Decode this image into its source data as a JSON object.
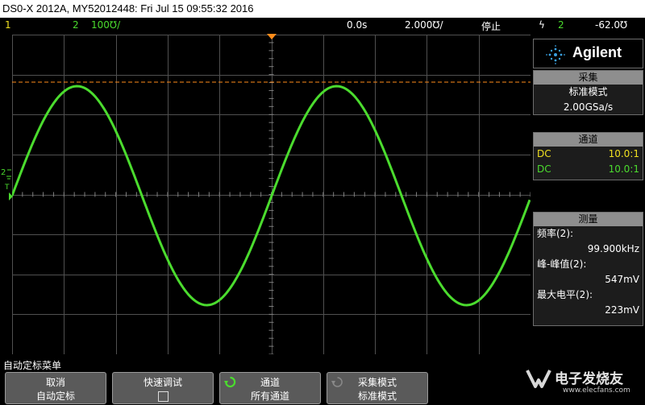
{
  "title": "DS0-X 2012A, MY52012448: Fri Jul 15 09:55:32 2016",
  "status": {
    "ch1": "1",
    "ch2": "2",
    "vscale": "100℧/",
    "time_delay": "0.0s",
    "time_scale": "2.000℧/",
    "run_state": "停止",
    "trigger_icon": "ϟ",
    "trigger_ch": "2",
    "trigger_level": "-62.0℧"
  },
  "brand": {
    "name": "Agilent",
    "icon": "agilent-spark-icon"
  },
  "acquisition": {
    "header": "采集",
    "mode": "标准模式",
    "rate": "2.00GSa/s"
  },
  "channels": {
    "header": "通道",
    "rows": [
      {
        "coupling": "DC",
        "probe": "10.0:1",
        "color": "#f0e020"
      },
      {
        "coupling": "DC",
        "probe": "10.0:1",
        "color": "#4bdc2e"
      }
    ]
  },
  "measurements": {
    "header": "测量",
    "items": [
      {
        "label": "频率(2):",
        "value": "99.900kHz"
      },
      {
        "label": "峰-峰值(2):",
        "value": "547mV"
      },
      {
        "label": "最大电平(2):",
        "value": "223mV"
      }
    ]
  },
  "menu": {
    "title": "自动定标菜单",
    "softkeys": [
      {
        "line1": "取消",
        "line2": "自动定标"
      },
      {
        "line1": "快速调试",
        "line2": ""
      },
      {
        "line1": "通道",
        "line2": "所有通道"
      },
      {
        "line1": "采集模式",
        "line2": "标准模式"
      }
    ]
  },
  "watermark": {
    "text": "电子发烧友",
    "url": "www.elecfans.com"
  },
  "colors": {
    "ch1": "#f0e020",
    "ch2": "#4bdc2e",
    "trigger": "#ff8c1a",
    "grid": "#5a5a5a",
    "panel_header": "#8e8e8e"
  },
  "waveform": {
    "channel": 2,
    "frequency_khz": 99.9,
    "vpp_mv": 547,
    "vmax_mv": 223
  }
}
